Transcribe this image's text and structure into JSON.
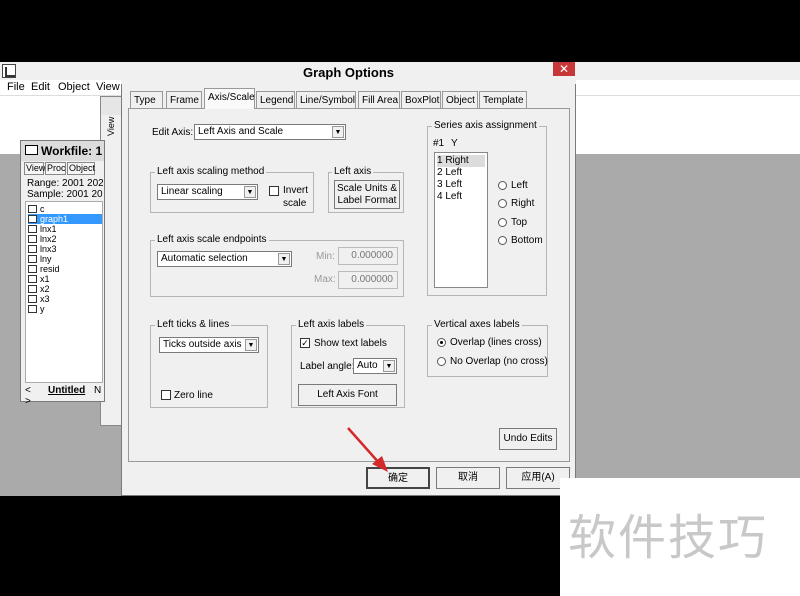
{
  "app": {
    "menu": [
      "File",
      "Edit",
      "Object",
      "View"
    ]
  },
  "workfile": {
    "title": "Workfile: 1",
    "buttons": [
      "View",
      "Proc",
      "Object"
    ],
    "range": "Range:  2001 202",
    "sample": "Sample: 2001 202",
    "items": [
      {
        "name": "c",
        "icon": "beta-icon",
        "selected": false
      },
      {
        "name": "graph1",
        "icon": "graph-icon",
        "selected": true
      },
      {
        "name": "lnx1",
        "icon": "series-icon",
        "selected": false
      },
      {
        "name": "lnx2",
        "icon": "series-icon",
        "selected": false
      },
      {
        "name": "lnx3",
        "icon": "series-icon",
        "selected": false
      },
      {
        "name": "lny",
        "icon": "series-icon",
        "selected": false
      },
      {
        "name": "resid",
        "icon": "series-icon",
        "selected": false
      },
      {
        "name": "x1",
        "icon": "series-icon",
        "selected": false
      },
      {
        "name": "x2",
        "icon": "series-icon",
        "selected": false
      },
      {
        "name": "x3",
        "icon": "series-icon",
        "selected": false
      },
      {
        "name": "y",
        "icon": "series-icon",
        "selected": false
      }
    ],
    "tab_nav": "< >",
    "tab_active": "Untitled",
    "tab_next": "N"
  },
  "background_window": {
    "label": "View"
  },
  "dialog": {
    "title": "Graph Options",
    "close": "✕",
    "tabs": [
      "Type",
      "Frame",
      "Axis/Scale",
      "Legend",
      "Line/Symbol",
      "Fill Area",
      "BoxPlot",
      "Object",
      "Template"
    ],
    "active_tab": "Axis/Scale",
    "edit_axis_label": "Edit Axis:",
    "edit_axis_value": "Left Axis and Scale",
    "scaling": {
      "title": "Left axis scaling method",
      "value": "Linear scaling",
      "invert_label_1": "Invert",
      "invert_label_2": "scale"
    },
    "left_axis": {
      "title": "Left axis",
      "button_line1": "Scale Units &",
      "button_line2": "Label Format"
    },
    "endpoints": {
      "title": "Left axis scale endpoints",
      "value": "Automatic selection",
      "min_label": "Min:",
      "min_value": "0.000000",
      "max_label": "Max:",
      "max_value": "0.000000"
    },
    "series_assign": {
      "title": "Series axis assignment",
      "header_num": "#1",
      "header_y": "Y",
      "rows": [
        "1  Right",
        "2  Left",
        "3  Left",
        "4  Left"
      ],
      "radios": [
        "Left",
        "Right",
        "Top",
        "Bottom"
      ]
    },
    "ticks": {
      "title": "Left ticks & lines",
      "value": "Ticks outside axis",
      "zero_line": "Zero line"
    },
    "labels": {
      "title": "Left axis labels",
      "show_text": "Show text labels",
      "show_text_checked": "✓",
      "angle_label": "Label angle:",
      "angle_value": "Auto",
      "font_button": "Left Axis Font"
    },
    "vertical": {
      "title": "Vertical axes labels",
      "overlap": "Overlap  (lines cross)",
      "no_overlap": "No Overlap (no cross)"
    },
    "undo": "Undo Edits",
    "ok": "确定",
    "cancel": "取消",
    "apply": "应用(A)"
  },
  "watermark": "软件技巧",
  "colors": {
    "selection": "#3399ff",
    "close_button": "#c83737",
    "arrow": "#d42a2a"
  }
}
